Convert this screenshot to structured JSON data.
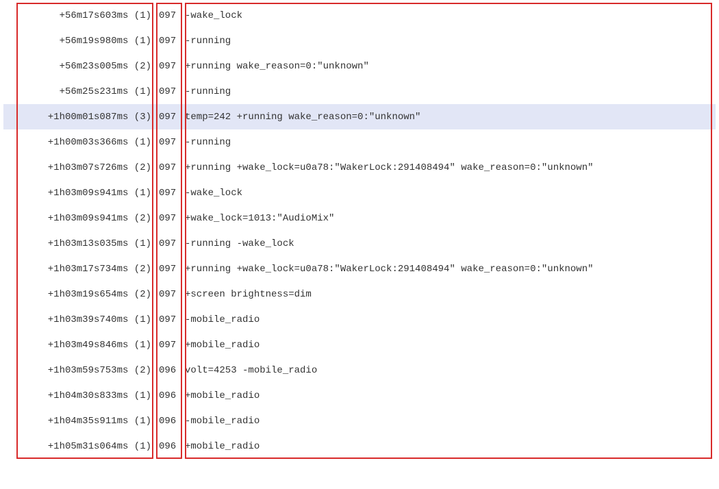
{
  "log": {
    "highlight_index": 4,
    "rows": [
      {
        "ts": "+56m17s603ms (1)",
        "code": "097",
        "msg": "-wake_lock"
      },
      {
        "ts": "+56m19s980ms (1)",
        "code": "097",
        "msg": "-running"
      },
      {
        "ts": "+56m23s005ms (2)",
        "code": "097",
        "msg": "+running wake_reason=0:\"unknown\""
      },
      {
        "ts": "+56m25s231ms (1)",
        "code": "097",
        "msg": "-running"
      },
      {
        "ts": "+1h00m01s087ms (3)",
        "code": "097",
        "msg": "temp=242 +running wake_reason=0:\"unknown\""
      },
      {
        "ts": "+1h00m03s366ms (1)",
        "code": "097",
        "msg": "-running"
      },
      {
        "ts": "+1h03m07s726ms (2)",
        "code": "097",
        "msg": "+running +wake_lock=u0a78:\"WakerLock:291408494\" wake_reason=0:\"unknown\""
      },
      {
        "ts": "+1h03m09s941ms (1)",
        "code": "097",
        "msg": "-wake_lock"
      },
      {
        "ts": "+1h03m09s941ms (2)",
        "code": "097",
        "msg": "+wake_lock=1013:\"AudioMix\""
      },
      {
        "ts": "+1h03m13s035ms (1)",
        "code": "097",
        "msg": "-running -wake_lock"
      },
      {
        "ts": "+1h03m17s734ms (2)",
        "code": "097",
        "msg": "+running +wake_lock=u0a78:\"WakerLock:291408494\" wake_reason=0:\"unknown\""
      },
      {
        "ts": "+1h03m19s654ms (2)",
        "code": "097",
        "msg": "+screen brightness=dim"
      },
      {
        "ts": "+1h03m39s740ms (1)",
        "code": "097",
        "msg": "-mobile_radio"
      },
      {
        "ts": "+1h03m49s846ms (1)",
        "code": "097",
        "msg": "+mobile_radio"
      },
      {
        "ts": "+1h03m59s753ms (2)",
        "code": "096",
        "msg": "volt=4253 -mobile_radio"
      },
      {
        "ts": "+1h04m30s833ms (1)",
        "code": "096",
        "msg": "+mobile_radio"
      },
      {
        "ts": "+1h04m35s911ms (1)",
        "code": "096",
        "msg": "-mobile_radio"
      },
      {
        "ts": "+1h05m31s064ms (1)",
        "code": "096",
        "msg": "+mobile_radio"
      }
    ]
  }
}
